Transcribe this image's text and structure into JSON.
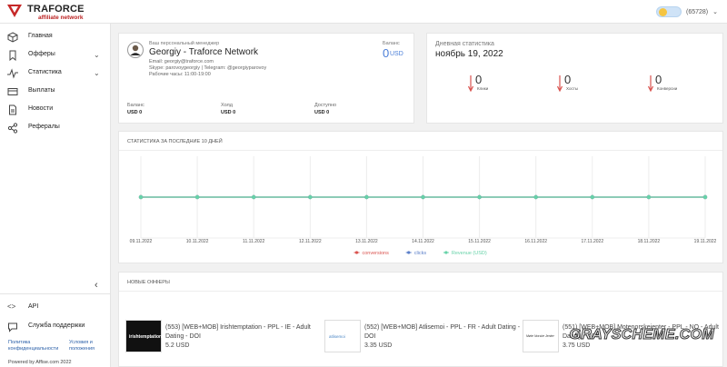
{
  "brand": {
    "name": "TRAFORCE",
    "tagline": "affiliate network"
  },
  "user": {
    "id": "(65728)"
  },
  "sidebar": {
    "items": [
      {
        "label": "Главная",
        "icon": "cube-icon"
      },
      {
        "label": "Офферы",
        "icon": "bookmark-icon"
      },
      {
        "label": "Статистика",
        "icon": "pulse-icon"
      },
      {
        "label": "Выплаты",
        "icon": "wallet-icon"
      },
      {
        "label": "Новости",
        "icon": "document-icon"
      },
      {
        "label": "Рефералы",
        "icon": "share-icon"
      }
    ],
    "api_label": "API",
    "support_label": "Служба поддержки",
    "policy_line1": "Политика",
    "policy_line2": "конфиденциальности",
    "terms_line1": "Условия и",
    "terms_line2": "положения",
    "powered": "Powered by Affise.com 2022"
  },
  "manager": {
    "caption": "Ваш персональный менеджер",
    "name": "Georgiy - Traforce Network",
    "email": "Email: georgiy@traforce.com",
    "skype": "Skype: parovoygeorgiy | Telegram: @georgiyparovoy",
    "hours": "Рабочие часы: 11:00-19:00",
    "balance_caption": "Баланс",
    "balance_value": "0",
    "balance_currency": "USD",
    "stats": [
      {
        "label": "Баланс",
        "value": "USD 0"
      },
      {
        "label": "Холд",
        "value": "USD 0"
      },
      {
        "label": "Доступно",
        "value": "USD 0"
      }
    ]
  },
  "daily": {
    "title": "Дневная статистика",
    "date": "ноябрь 19, 2022",
    "metrics": [
      {
        "value": "0",
        "label": "Клики"
      },
      {
        "value": "0",
        "label": "Хосты"
      },
      {
        "value": "0",
        "label": "Конверсии"
      }
    ]
  },
  "stats_title": "СТАТИСТИКА ЗА ПОСЛЕДНИЕ 10 ДНЕЙ",
  "chart_data": {
    "type": "line",
    "x": [
      "09.11.2022",
      "10.11.2022",
      "11.11.2022",
      "12.11.2022",
      "13.11.2022",
      "14.11.2022",
      "15.11.2022",
      "16.11.2022",
      "17.11.2022",
      "18.11.2022",
      "19.11.2022"
    ],
    "series": [
      {
        "name": "conversions",
        "values": [
          0,
          0,
          0,
          0,
          0,
          0,
          0,
          0,
          0,
          0,
          0
        ],
        "color": "#d9534f"
      },
      {
        "name": "clicks",
        "values": [
          0,
          0,
          0,
          0,
          0,
          0,
          0,
          0,
          0,
          0,
          0
        ],
        "color": "#5b7fc9"
      },
      {
        "name": "Revenue (USD)",
        "values": [
          0,
          0,
          0,
          0,
          0,
          0,
          0,
          0,
          0,
          0,
          0
        ],
        "color": "#66d2a8"
      }
    ],
    "legend_position": "bottom"
  },
  "offers_title": "НОВЫЕ ОФФЕРЫ",
  "offers": [
    {
      "name": "(553) [WEB+MOB] Irishtemptation - PPL - IE - Adult Dating - DOI",
      "price": "5.2 USD",
      "thumb_text": "irishtemptation"
    },
    {
      "name": "(552) [WEB+MOB] Atlisemoi - PPL - FR - Adult Dating - DOI",
      "price": "3.35 USD",
      "thumb_text": "atlisemoi"
    },
    {
      "name": "(551) [WEB+MOB] Motenorskejenter - PPL - NO - Adult Dating - DOI",
      "price": "3.75 USD",
      "thumb_text": "Møte Norske Jenter"
    }
  ],
  "watermark": "GRAYSCHEME.COM"
}
